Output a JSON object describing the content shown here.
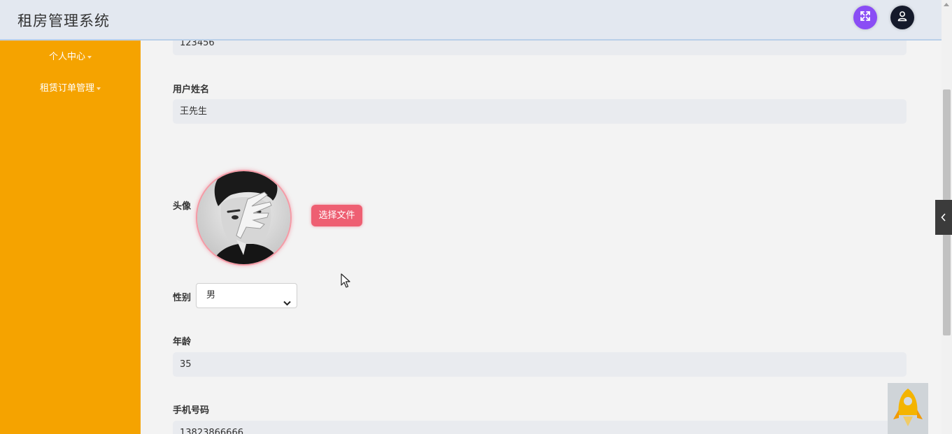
{
  "header": {
    "app_title": "租房管理系统",
    "icons": {
      "fullscreen": "fullscreen-expand-icon",
      "user": "user-icon"
    },
    "colors": {
      "fullscreen_button": "#8a4df5",
      "user_button": "#151a2b"
    }
  },
  "sidebar": {
    "background": "#f5a300",
    "items": [
      {
        "label": "个人中心"
      },
      {
        "label": "租赁订单管理"
      }
    ]
  },
  "form": {
    "password_value": "123456",
    "username": {
      "label": "用户姓名",
      "value": "王先生"
    },
    "avatar": {
      "label": "头像",
      "choose_button": "选择文件"
    },
    "gender": {
      "label": "性别",
      "selected": "男"
    },
    "age": {
      "label": "年龄",
      "value": "35"
    },
    "phone": {
      "label": "手机号码",
      "value": "13823866666"
    }
  }
}
